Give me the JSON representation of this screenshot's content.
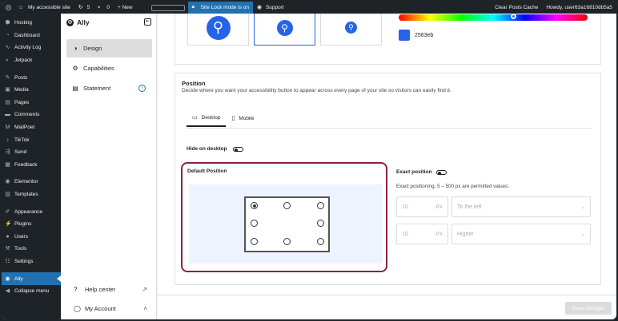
{
  "adminbar": {
    "site_name": "My accessible site",
    "updates_count": "5",
    "comments_count": "0",
    "new_label": "+ New",
    "site_lock": "Site Lock mode is on",
    "support": "Support",
    "clear_cache": "Clear Posts Cache",
    "howdy": "Howdy, user63a16810db5a5"
  },
  "wp_menu": {
    "items": [
      "Hosting",
      "Dashboard",
      "Activity Log",
      "Jetpack",
      "Posts",
      "Media",
      "Pages",
      "Comments",
      "MailPoet",
      "TikTok",
      "Send",
      "Feedback",
      "Elementor",
      "Templates",
      "Appearance",
      "Plugins",
      "Users",
      "Tools",
      "Settings",
      "Ally",
      "Collapse menu"
    ]
  },
  "ally_panel": {
    "title": "Ally",
    "nav": [
      "Design",
      "Capabilities",
      "Statement"
    ],
    "help_center": "Help center",
    "my_account": "My Account"
  },
  "design": {
    "hex_value": "2563eb",
    "accent_color": "#2563eb",
    "hue_position": 0.61
  },
  "position": {
    "title": "Position",
    "subtitle": "Decide where you want your accessibility button to appear across every page of your site so visitors can easily find it.",
    "tabs": [
      "Desktop",
      "Mobile"
    ],
    "hide_on_desktop": "Hide on desktop",
    "default_position": "Default Position",
    "exact_position": "Exact position",
    "exact_note": "Exact positioning, 5 – 500 px are permitted values:",
    "h_value": "10",
    "h_unit": "PX",
    "h_direction": "To the left",
    "v_value": "10",
    "v_unit": "PX",
    "v_direction": "Higher"
  },
  "footer": {
    "save": "Save changes"
  }
}
